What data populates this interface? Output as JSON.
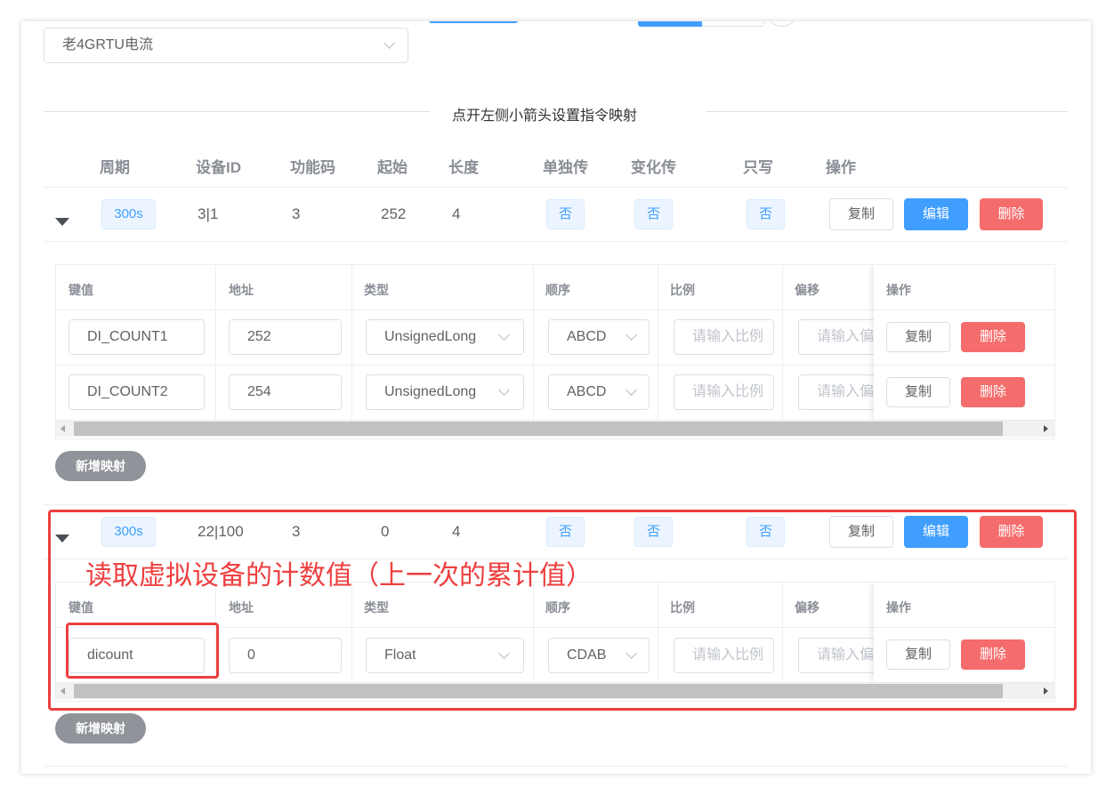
{
  "device_select": {
    "value": "老4GRTU电流"
  },
  "divider": {
    "text": "点开左侧小箭头设置指令映射"
  },
  "headers": [
    "周期",
    "设备ID",
    "功能码",
    "起始",
    "长度",
    "单独传",
    "变化传",
    "只写",
    "操作"
  ],
  "commands": [
    {
      "period": "300s",
      "device_id": "3|1",
      "func_code": "3",
      "start": "252",
      "length": "4",
      "single": "否",
      "change": "否",
      "write_only": "否",
      "actions": {
        "copy": "复制",
        "edit": "编辑",
        "delete": "删除"
      },
      "mapping_headers": [
        "键值",
        "地址",
        "类型",
        "顺序",
        "比例",
        "偏移",
        "操作"
      ],
      "mappings": [
        {
          "key": "DI_COUNT1",
          "address": "252",
          "type": "UnsignedLong",
          "order": "ABCD",
          "ratio_placeholder": "请输入比例",
          "offset_placeholder": "请输入偏移",
          "copy": "复制",
          "delete": "删除"
        },
        {
          "key": "DI_COUNT2",
          "address": "254",
          "type": "UnsignedLong",
          "order": "ABCD",
          "ratio_placeholder": "请输入比例",
          "offset_placeholder": "请输入偏移",
          "copy": "复制",
          "delete": "删除"
        }
      ],
      "add_mapping": "新增映射"
    },
    {
      "period": "300s",
      "device_id": "22|100",
      "func_code": "3",
      "start": "0",
      "length": "4",
      "single": "否",
      "change": "否",
      "write_only": "否",
      "actions": {
        "copy": "复制",
        "edit": "编辑",
        "delete": "删除"
      },
      "mapping_headers": [
        "键值",
        "地址",
        "类型",
        "顺序",
        "比例",
        "偏移",
        "操作"
      ],
      "mappings": [
        {
          "key": "dicount",
          "address": "0",
          "type": "Float",
          "order": "CDAB",
          "ratio_placeholder": "请输入比例",
          "offset_placeholder": "请输入偏移",
          "copy": "复制",
          "delete": "删除"
        }
      ],
      "add_mapping": "新增映射"
    }
  ],
  "annotation": {
    "text": "读取虚拟设备的计数值（上一次的累计值）"
  },
  "colors": {
    "primary": "#409eff",
    "danger": "#f56c6c",
    "annotation": "#ee3f3f",
    "tag_bg": "#ecf5ff"
  }
}
